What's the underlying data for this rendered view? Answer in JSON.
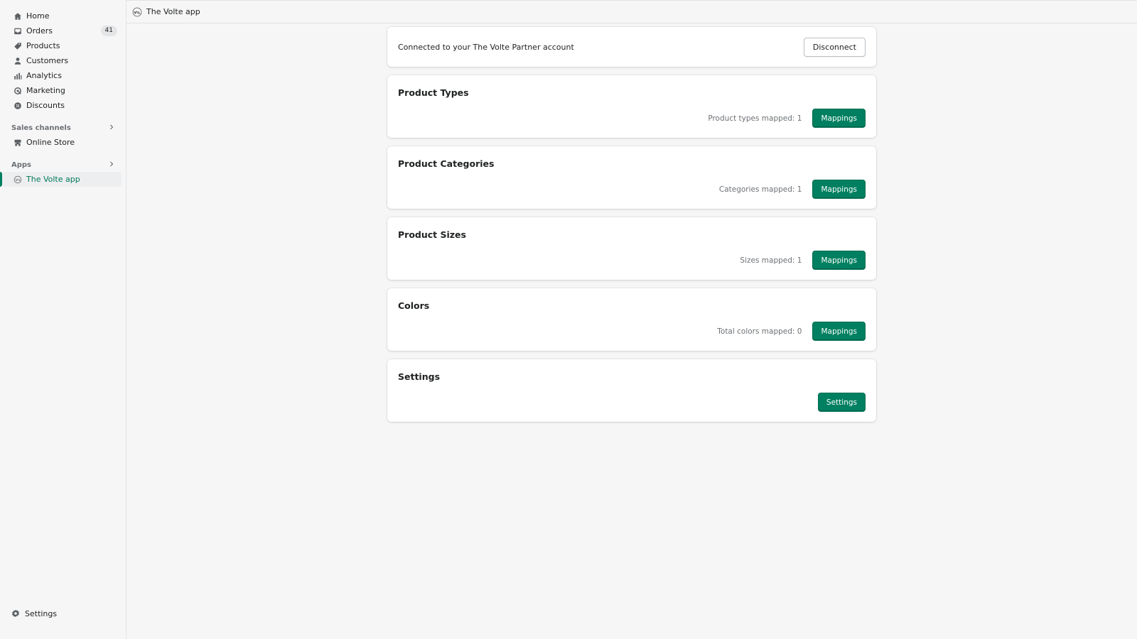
{
  "app": {
    "title": "The Volte app"
  },
  "sidebar": {
    "items": [
      {
        "key": "home",
        "label": "Home",
        "icon": "home-icon"
      },
      {
        "key": "orders",
        "label": "Orders",
        "icon": "orders-icon",
        "badge": "41"
      },
      {
        "key": "products",
        "label": "Products",
        "icon": "tag-icon"
      },
      {
        "key": "customers",
        "label": "Customers",
        "icon": "person-icon"
      },
      {
        "key": "analytics",
        "label": "Analytics",
        "icon": "bar-chart-icon"
      },
      {
        "key": "marketing",
        "label": "Marketing",
        "icon": "target-icon"
      },
      {
        "key": "discounts",
        "label": "Discounts",
        "icon": "discount-icon"
      }
    ],
    "sales_channels": {
      "heading": "Sales channels",
      "items": [
        {
          "label": "Online Store",
          "icon": "store-icon"
        }
      ]
    },
    "apps": {
      "heading": "Apps",
      "items": [
        {
          "label": "The Volte app",
          "icon": "volte-logo-icon",
          "active": true
        }
      ]
    },
    "settings_label": "Settings"
  },
  "connection": {
    "text": "Connected to your The Volte Partner account",
    "disconnect_label": "Disconnect"
  },
  "sections": [
    {
      "title": "Product Types",
      "meta": "Product types mapped: 1",
      "button": "Mappings"
    },
    {
      "title": "Product Categories",
      "meta": "Categories mapped: 1",
      "button": "Mappings"
    },
    {
      "title": "Product Sizes",
      "meta": "Sizes mapped: 1",
      "button": "Mappings"
    },
    {
      "title": "Colors",
      "meta": "Total colors mapped: 0",
      "button": "Mappings"
    },
    {
      "title": "Settings",
      "meta": "",
      "button": "Settings"
    }
  ],
  "colors": {
    "primary": "#008060",
    "active_text": "#007a5a",
    "muted": "#6d7175"
  }
}
